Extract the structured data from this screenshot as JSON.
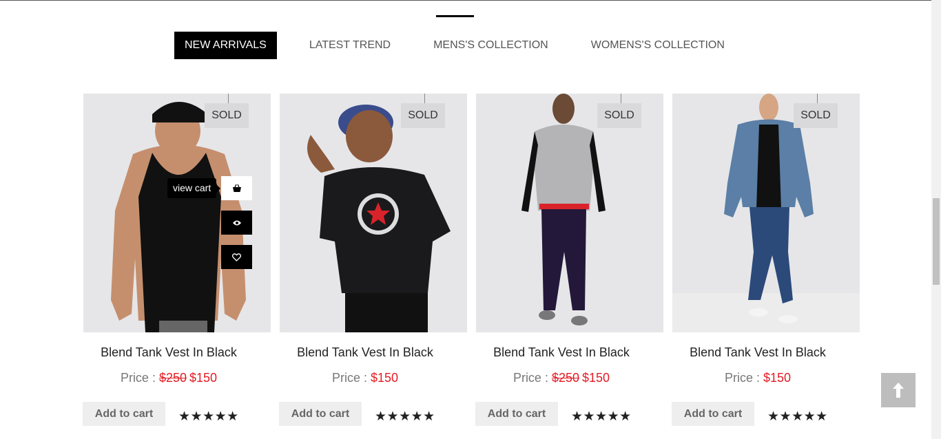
{
  "tabs": [
    {
      "label": "NEW ARRIVALS",
      "active": true
    },
    {
      "label": "LATEST TREND",
      "active": false
    },
    {
      "label": "MENS'S COLLECTION",
      "active": false
    },
    {
      "label": "WOMENS'S COLLECTION",
      "active": false
    }
  ],
  "products": [
    {
      "badge": "SOLD",
      "title": "Blend Tank Vest In Black",
      "price_label": "Price : ",
      "old_price": "$250",
      "price": "$150",
      "add_label": "Add to cart",
      "rating": 5,
      "stars": "★★★★★"
    },
    {
      "badge": "SOLD",
      "title": "Blend Tank Vest In Black",
      "price_label": "Price : ",
      "old_price": "",
      "price": "$150",
      "add_label": "Add to cart",
      "rating": 5,
      "stars": "★★★★★"
    },
    {
      "badge": "SOLD",
      "title": "Blend Tank Vest In Black",
      "price_label": "Price : ",
      "old_price": "$250",
      "price": "$150",
      "add_label": "Add to cart",
      "rating": 5,
      "stars": "★★★★★"
    },
    {
      "badge": "SOLD",
      "title": "Blend Tank Vest In Black",
      "price_label": "Price : ",
      "old_price": "",
      "price": "$150",
      "add_label": "Add to cart",
      "rating": 5,
      "stars": "★★★★★"
    }
  ],
  "hover_actions": {
    "tooltip": "view cart",
    "icons": [
      "basket-icon",
      "eye-icon",
      "heart-icon"
    ]
  },
  "scroll_top_icon": "arrow-up-icon",
  "colors": {
    "accent": "#000000",
    "sale": "#e31b23",
    "muted": "#777777"
  }
}
